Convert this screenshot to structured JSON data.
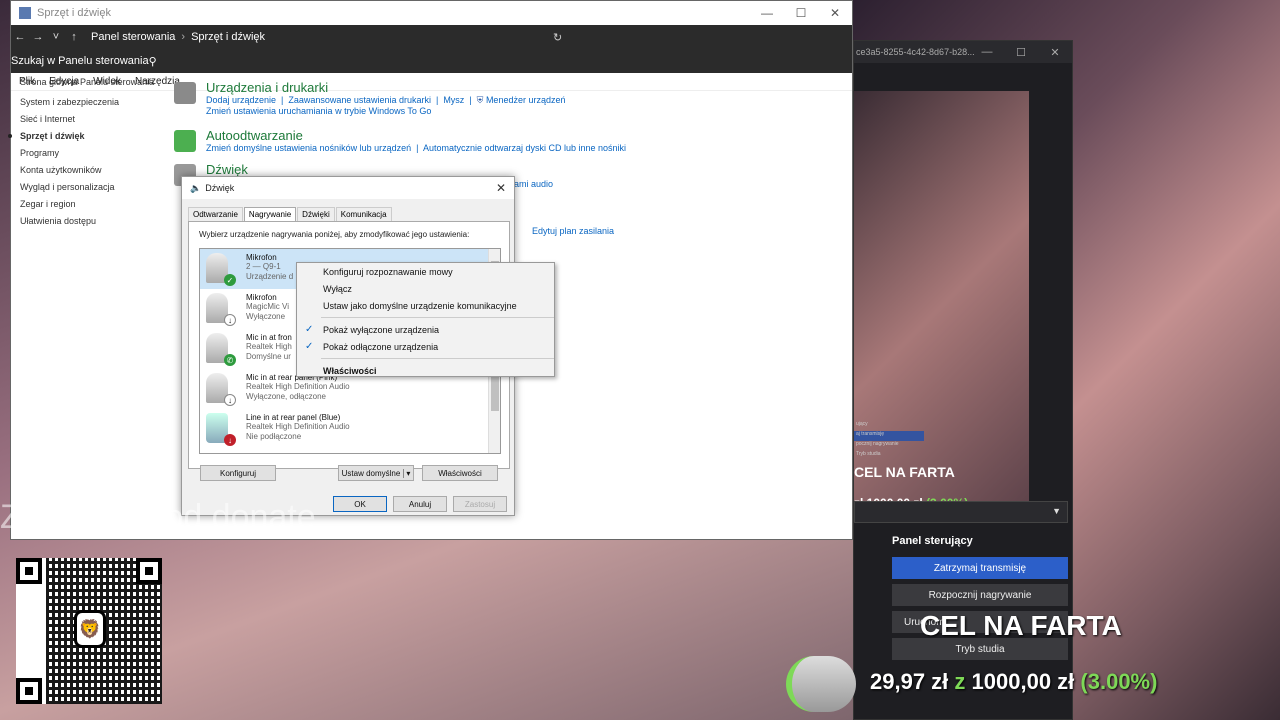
{
  "cp": {
    "title": "Sprzęt i dźwięk",
    "path": [
      "Panel sterowania",
      "Sprzęt i dźwięk"
    ],
    "search_placeholder": "Szukaj w Panelu sterowania",
    "menu": [
      "Plik",
      "Edycja",
      "Widok",
      "Narzędzia"
    ],
    "side": [
      "Strona główna Panelu sterowania",
      "System i zabezpieczenia",
      "Sieć i Internet",
      "Sprzęt i dźwięk",
      "Programy",
      "Konta użytkowników",
      "Wygląd i personalizacja",
      "Zegar i region",
      "Ułatwienia dostępu"
    ],
    "sec1": {
      "h": "Urządzenia i drukarki",
      "l1": "Dodaj urządzenie",
      "l2": "Zaawansowane ustawienia drukarki",
      "l3": "Mysz",
      "l4": "Menedżer urządzeń",
      "l5": "Zmień ustawienia uruchamiania w trybie Windows To Go"
    },
    "sec2": {
      "h": "Autoodtwarzanie",
      "l1": "Zmień domyślne ustawienia nośników lub urządzeń",
      "l2": "Automatycznie odtwarzaj dyski CD lub inne nośniki"
    },
    "sec3": {
      "h": "Dźwięk",
      "l1": "ami audio",
      "l2": "Edytuj plan zasilania"
    }
  },
  "dlg": {
    "title": "Dźwięk",
    "tabs": [
      "Odtwarzanie",
      "Nagrywanie",
      "Dźwięki",
      "Komunikacja"
    ],
    "instr": "Wybierz urządzenie nagrywania poniżej, aby zmodyfikować jego ustawienia:",
    "items": [
      {
        "n": "Mikrofon",
        "s1": "2 — Q9-1",
        "s2": "Urządzenie d"
      },
      {
        "n": "Mikrofon",
        "s1": "MagicMic Vi",
        "s2": "Wyłączone"
      },
      {
        "n": "Mic in at fron",
        "s1": "Realtek High",
        "s2": "Domyślne ur"
      },
      {
        "n": "Mic in at rear panel (Pink)",
        "s1": "Realtek High Definition Audio",
        "s2": "Wyłączone, odłączone"
      },
      {
        "n": "Line in at rear panel (Blue)",
        "s1": "Realtek High Definition Audio",
        "s2": "Nie podłączone"
      }
    ],
    "btn_config": "Konfiguruj",
    "btn_default": "Ustaw domyślne",
    "btn_props": "Właściwości",
    "btn_ok": "OK",
    "btn_cancel": "Anuluj",
    "btn_apply": "Zastosuj"
  },
  "ctx": {
    "i1": "Konfiguruj rozpoznawanie mowy",
    "i2": "Wyłącz",
    "i3": "Ustaw jako domyślne urządzenie komunikacyjne",
    "i4": "Pokaż wyłączone urządzenia",
    "i5": "Pokaż odłączone urządzenia",
    "i6": "Właściwości"
  },
  "obs": {
    "title": "ce3a5-8255-4c42-8d67-b28...",
    "mini_list": [
      "ujący",
      "aj transmisję",
      "pocznij nagrywanie",
      "Tryb studia"
    ],
    "mini_title": "CEL NA FARTA",
    "mini_amt": "zł 1000,00 zł",
    "mini_pct": "(3.00%)",
    "panel_h": "Panel sterujący",
    "b1": "Zatrzymaj transmisję",
    "b2": "Rozpocznij nagrywanie",
    "b3": "Uruchom",
    "b4": "Tryb studia"
  },
  "overlay": {
    "title": "CEL NA FARTA",
    "amt1": "29,97 zł",
    "z": "z",
    "amt2": "1000,00 zł",
    "pct": "(3.00%)",
    "watermark": "Zeskanuj kod donate"
  }
}
